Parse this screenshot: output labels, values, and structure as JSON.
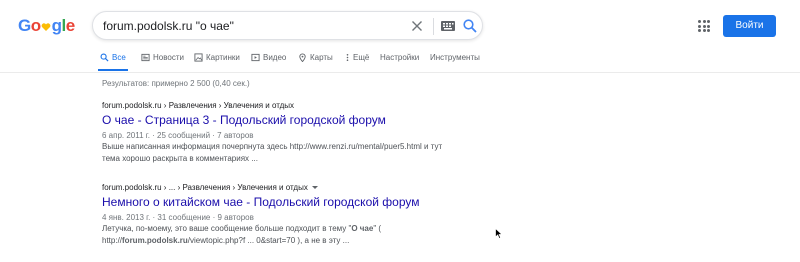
{
  "header": {
    "logo_text": "Google",
    "search": {
      "value": "forum.podolsk.ru \"о чае\""
    },
    "signin_label": "Войти"
  },
  "tabs": [
    {
      "label": "Все",
      "icon": "search-icon",
      "active": true
    },
    {
      "label": "Новости",
      "icon": "news-icon"
    },
    {
      "label": "Картинки",
      "icon": "image-icon"
    },
    {
      "label": "Видео",
      "icon": "video-icon"
    },
    {
      "label": "Карты",
      "icon": "map-pin-icon"
    },
    {
      "label": "Ещё",
      "icon": "more-vert-icon"
    },
    {
      "label": "Настройки"
    },
    {
      "label": "Инструменты"
    }
  ],
  "stats": "Результатов: примерно 2 500 (0,40 сек.)",
  "results": [
    {
      "breadcrumb": "forum.podolsk.ru › Развлечения › Увлечения и отдых",
      "title": "О чае - Страница 3 - Подольский городской форум",
      "meta": "6 апр. 2011 г. · 25 сообщений · 7 авторов",
      "snippet_line1": "Выше написанная информация почерпнута здесь http://www.renzi.ru/mental/puer5.html и тут",
      "snippet_line2": "тема хорошо раскрыта в комментариях ..."
    },
    {
      "breadcrumb": "forum.podolsk.ru › ... › Развлечения › Увлечения и отдых",
      "title": "Немного о китайском чае - Подольский городской форум",
      "meta": "4 янв. 2013 г. · 31 сообщение · 9 авторов",
      "snippet_line1_a": "Летучка, по-моему, это ваше сообщение больше подходит в тему \"",
      "snippet_line1_b": "О чае",
      "snippet_line1_c": "\" (",
      "snippet_line2_a": "http://",
      "snippet_line2_b": "forum.podolsk.ru",
      "snippet_line2_c": "/viewtopic.php?f ... 0&start=70 ), а не в эту ..."
    }
  ],
  "colors": {
    "accent": "#1a73e8",
    "link": "#1a0dab",
    "logo": [
      "#4285f4",
      "#ea4335",
      "#fbbc05",
      "#4285f4",
      "#34a853",
      "#ea4335"
    ]
  }
}
